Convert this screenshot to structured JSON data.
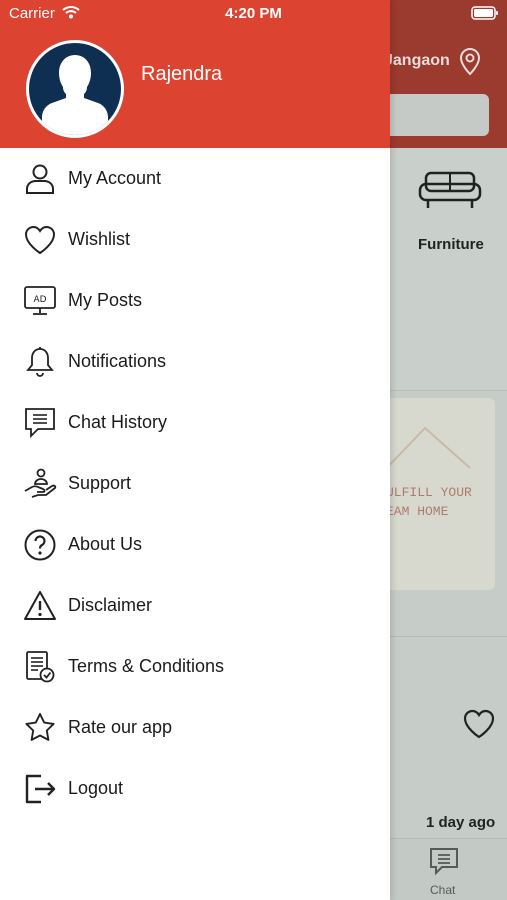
{
  "status_bar": {
    "carrier": "Carrier",
    "time": "4:20 PM"
  },
  "background": {
    "location": "Jangaon",
    "category_label": "Furniture",
    "banner_lines": "ULFILL YOUR\nEAM HOME",
    "post_time": "1 day ago",
    "tab_chat": "Chat"
  },
  "drawer": {
    "user_name": "Rajendra",
    "menu": [
      {
        "label": "My Account",
        "icon": "user-icon"
      },
      {
        "label": "Wishlist",
        "icon": "heart-icon"
      },
      {
        "label": "My Posts",
        "icon": "ad-monitor-icon"
      },
      {
        "label": "Notifications",
        "icon": "bell-icon"
      },
      {
        "label": "Chat History",
        "icon": "chat-bubble-icon"
      },
      {
        "label": "Support",
        "icon": "support-hand-icon"
      },
      {
        "label": "About Us",
        "icon": "question-circle-icon"
      },
      {
        "label": "Disclaimer",
        "icon": "warning-icon"
      },
      {
        "label": "Terms & Conditions",
        "icon": "document-check-icon"
      },
      {
        "label": "Rate our app",
        "icon": "star-icon"
      },
      {
        "label": "Logout",
        "icon": "logout-icon"
      }
    ]
  },
  "colors": {
    "header_red": "#dc4331",
    "avatar_navy": "#0f2f52"
  }
}
